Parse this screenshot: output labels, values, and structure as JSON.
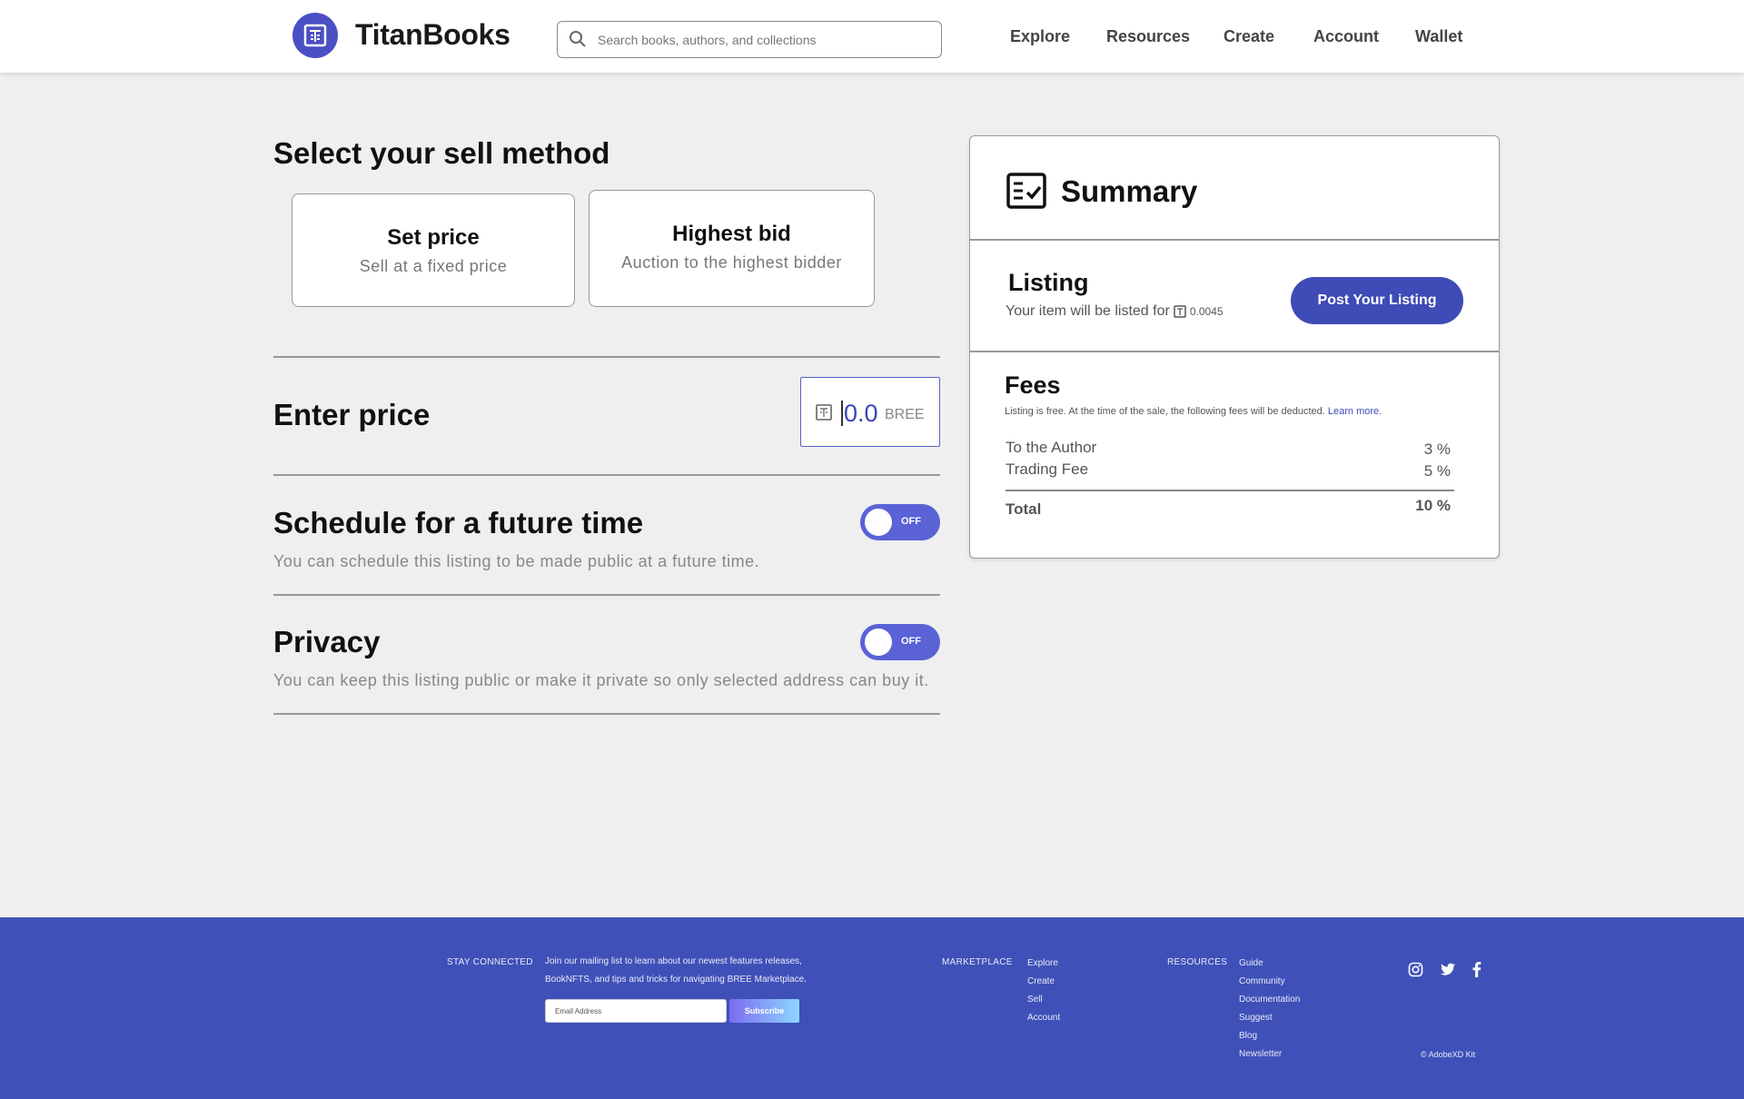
{
  "header": {
    "logo_text": "TitanBooks",
    "search_placeholder": "Search books, authors, and collections",
    "nav": [
      "Explore",
      "Resources",
      "Create",
      "Account",
      "Wallet"
    ]
  },
  "sell": {
    "title": "Select your sell method",
    "methods": [
      {
        "title": "Set price",
        "subtitle": "Sell at a fixed price"
      },
      {
        "title": "Highest bid",
        "subtitle": "Auction to the highest bidder"
      }
    ]
  },
  "price": {
    "title": "Enter price",
    "value": "0.0",
    "unit": "BREE"
  },
  "schedule": {
    "title": "Schedule for a future time",
    "subtitle": "You can schedule this listing to be made public at a future time.",
    "toggle": "OFF"
  },
  "privacy": {
    "title": "Privacy",
    "subtitle": "You can keep this listing public or make it private so only selected address can buy it.",
    "toggle": "OFF"
  },
  "summary": {
    "title": "Summary",
    "listing_title": "Listing",
    "listing_text": "Your item will be listed for",
    "listing_amount": "0.0045",
    "post_button": "Post Your Listing",
    "fees_title": "Fees",
    "fees_note": "Listing is free. At the time of the sale, the following fees will be deducted.",
    "learn_more": "Learn more.",
    "fees": [
      {
        "label": "To the Author",
        "value": "3 %"
      },
      {
        "label": "Trading Fee",
        "value": "5 %"
      }
    ],
    "total_label": "Total",
    "total_value": "10 %"
  },
  "footer": {
    "stay_connected": "STAY CONNECTED",
    "newsletter_line1": "Join our mailing list to learn about our newest features releases,",
    "newsletter_line2": "BookNFTS, and tips and tricks for navigating BREE Marketplace.",
    "email_placeholder": "Email Address",
    "subscribe": "Subscribe",
    "marketplace_label": "MARKETPLACE",
    "marketplace_links": [
      "Explore",
      "Create",
      "Sell",
      "Account"
    ],
    "resources_label": "RESOURCES",
    "resources_links": [
      "Guide",
      "Community",
      "Documentation",
      "Suggest",
      "Blog",
      "Newsletter"
    ],
    "copyright": "© AdobeXD Kit"
  },
  "colors": {
    "brand": "#3f51b8",
    "accent": "#5a62d6"
  }
}
